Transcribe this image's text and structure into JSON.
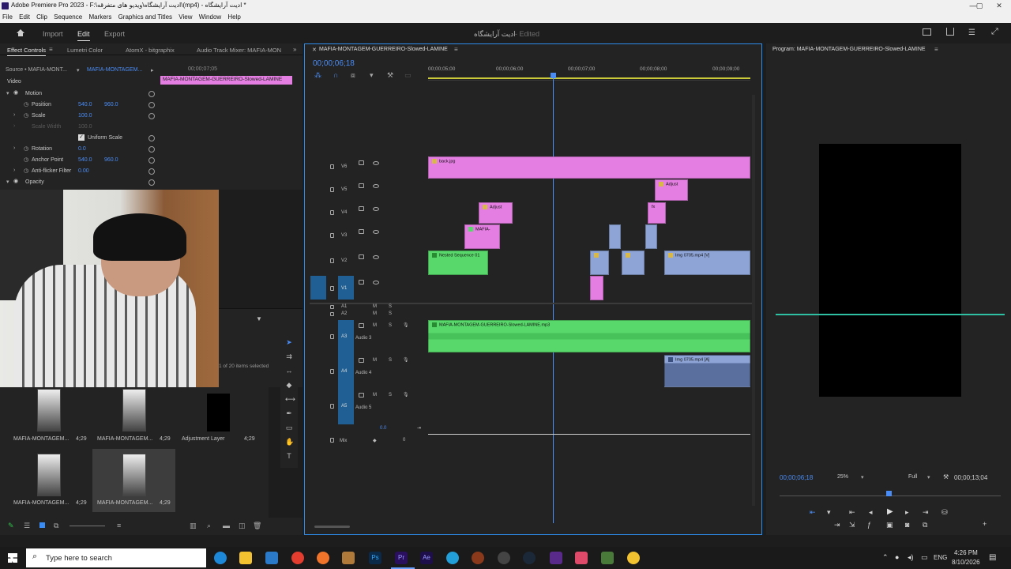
{
  "titlebar": {
    "title": "Adobe Premiere Pro 2023 - F:\\ادیت آرایشگاه\\ویدیو های متفرقه\\(mp4) - ادیت آرایشگاه *"
  },
  "menubar": [
    "File",
    "Edit",
    "Clip",
    "Sequence",
    "Markers",
    "Graphics and Titles",
    "View",
    "Window",
    "Help"
  ],
  "workspace": {
    "tabs": [
      "Import",
      "Edit",
      "Export"
    ],
    "active": "Edit",
    "project_title": "ادیت آرایشگاه",
    "state": "- Edited"
  },
  "effect_controls": {
    "tabs": [
      "Effect Controls",
      "Lumetri Color",
      "AtomX - bitgraphix",
      "Audio Track Mixer: MAFIA-MON"
    ],
    "source": "Source • MAFIA-MONT...",
    "sequence": "MAFIA-MONTAGEM...",
    "timecode": "00;00;07;05",
    "clip_label": "MAFIA-MONTAGEM-GUERREIRO-Slowed-LAMINE",
    "video_label": "Video",
    "motion": "Motion",
    "rows": [
      {
        "name": "Position",
        "v1": "540.0",
        "v2": "960.0"
      },
      {
        "name": "Scale",
        "v1": "100.0",
        "v2": ""
      },
      {
        "name": "Scale Width",
        "v1": "100.0",
        "v2": ""
      },
      {
        "name": "Uniform Scale",
        "v1": "",
        "v2": ""
      },
      {
        "name": "Rotation",
        "v1": "0.0",
        "v2": ""
      },
      {
        "name": "Anchor Point",
        "v1": "540.0",
        "v2": "960.0"
      },
      {
        "name": "Anti-flicker Filter",
        "v1": "0.00",
        "v2": ""
      }
    ],
    "opacity": "Opacity"
  },
  "project": {
    "selected": "1 of 20 items selected",
    "items": [
      {
        "name": "MAFIA-MONTAGEM...",
        "dur": "4;29"
      },
      {
        "name": "MAFIA-MONTAGEM...",
        "dur": "4;29"
      },
      {
        "name": "Adjustment Layer",
        "dur": "4;29"
      },
      {
        "name": "MAFIA-MONTAGEM...",
        "dur": "4;29"
      },
      {
        "name": "MAFIA-MONTAGEM...",
        "dur": "4;29"
      }
    ]
  },
  "timeline": {
    "tab": "MAFIA-MONTAGEM-GUERREIRO-Slowed-LAMINE",
    "timecode": "00;00;06;18",
    "ruler": [
      "00;00;05;00",
      "00;00;06;00",
      "00;00;07;00",
      "00;00;08;00",
      "00;00;09;00"
    ],
    "video_tracks": [
      "V6",
      "V5",
      "V4",
      "V3",
      "V2",
      "V1"
    ],
    "audio_tracks": [
      {
        "id": "A1",
        "name": ""
      },
      {
        "id": "A2",
        "name": ""
      },
      {
        "id": "A3",
        "name": "Audio 3"
      },
      {
        "id": "A4",
        "name": "Audio 4"
      },
      {
        "id": "A5",
        "name": "Audio 5"
      }
    ],
    "mix_label": "Mix",
    "mix_value": "0.0",
    "clips": {
      "back": "back.jpg",
      "adjust1": "Adjust",
      "adjust2": "Adjust",
      "mafia": "MAFIA-",
      "nested": "Nested Sequence 01",
      "img_v": "Img 0705.mp4 [V]",
      "audio_main": "MAFIA-MONTAGEM-GUERREIRO-Slowed-LAMINE.mp3",
      "img_a": "Img 0705.mp4 [A]",
      "small_fx": "fx"
    }
  },
  "program": {
    "title": "Program: MAFIA-MONTAGEM-GUERREIRO-Slowed-LAMINE",
    "timecode": "00;00;06;18",
    "zoom": "25%",
    "quality": "Full",
    "duration": "00;00;13;04"
  },
  "taskbar": {
    "search_placeholder": "Type here to search",
    "lang": "ENG",
    "time": "4:26 PM",
    "date": "8/10/2026"
  },
  "colors": {
    "accent": "#2d8ceb",
    "clip_pink": "#e57ee2",
    "clip_green": "#58d86a",
    "clip_blue": "#8ea4d6"
  }
}
